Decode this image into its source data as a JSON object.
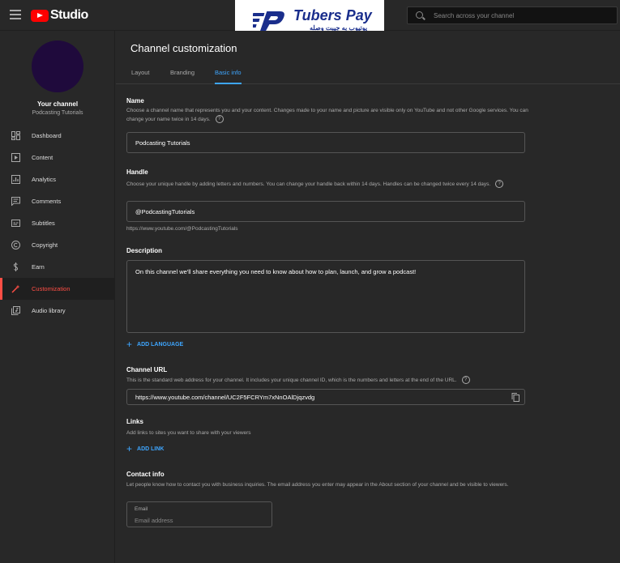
{
  "app": {
    "logo_text": "Studio",
    "search_placeholder": "Search across your channel"
  },
  "watermark": {
    "title": "Tubers Pay",
    "subtitle": "یوتیوب به جیبت وصله"
  },
  "sidebar": {
    "channel_label": "Your channel",
    "channel_name": "Podcasting Tutorials",
    "items": [
      {
        "label": "Dashboard",
        "icon": "dashboard-icon"
      },
      {
        "label": "Content",
        "icon": "content-icon"
      },
      {
        "label": "Analytics",
        "icon": "analytics-icon"
      },
      {
        "label": "Comments",
        "icon": "comments-icon"
      },
      {
        "label": "Subtitles",
        "icon": "subtitles-icon"
      },
      {
        "label": "Copyright",
        "icon": "copyright-icon"
      },
      {
        "label": "Earn",
        "icon": "earn-icon"
      },
      {
        "label": "Customization",
        "icon": "customization-icon",
        "active": true
      },
      {
        "label": "Audio library",
        "icon": "audio-library-icon"
      }
    ]
  },
  "main": {
    "title": "Channel customization",
    "tabs": [
      {
        "label": "Layout"
      },
      {
        "label": "Branding"
      },
      {
        "label": "Basic info",
        "active": true
      }
    ],
    "name": {
      "title": "Name",
      "desc": "Choose a channel name that represents you and your content. Changes made to your name and picture are visible only on YouTube and not other Google services. You can change your name twice in 14 days.",
      "value": "Podcasting Tutorials"
    },
    "handle": {
      "title": "Handle",
      "desc": "Choose your unique handle by adding letters and numbers. You can change your handle back within 14 days. Handles can be changed twice every 14 days.",
      "value": "@PodcastingTutorials",
      "url_hint": "https://www.youtube.com/@PodcastingTutorials"
    },
    "description": {
      "title": "Description",
      "value": "On this channel we'll share everything you need to know about how to plan, launch, and grow a podcast!",
      "add_language": "ADD LANGUAGE"
    },
    "channel_url": {
      "title": "Channel URL",
      "desc": "This is the standard web address for your channel. It includes your unique channel ID, which is the numbers and letters at the end of the URL.",
      "value": "https://www.youtube.com/channel/UC2F5FCRYm7xNnOAlDjqzvdg"
    },
    "links": {
      "title": "Links",
      "desc": "Add links to sites you want to share with your viewers",
      "add_link": "ADD LINK"
    },
    "contact": {
      "title": "Contact info",
      "desc": "Let people know how to contact you with business inquiries. The email address you enter may appear in the About section of your channel and be visible to viewers.",
      "email_label": "Email",
      "email_placeholder": "Email address"
    }
  },
  "colors": {
    "accent": "#3ea6ff",
    "active_nav": "#ff4e45",
    "background": "#282828"
  }
}
